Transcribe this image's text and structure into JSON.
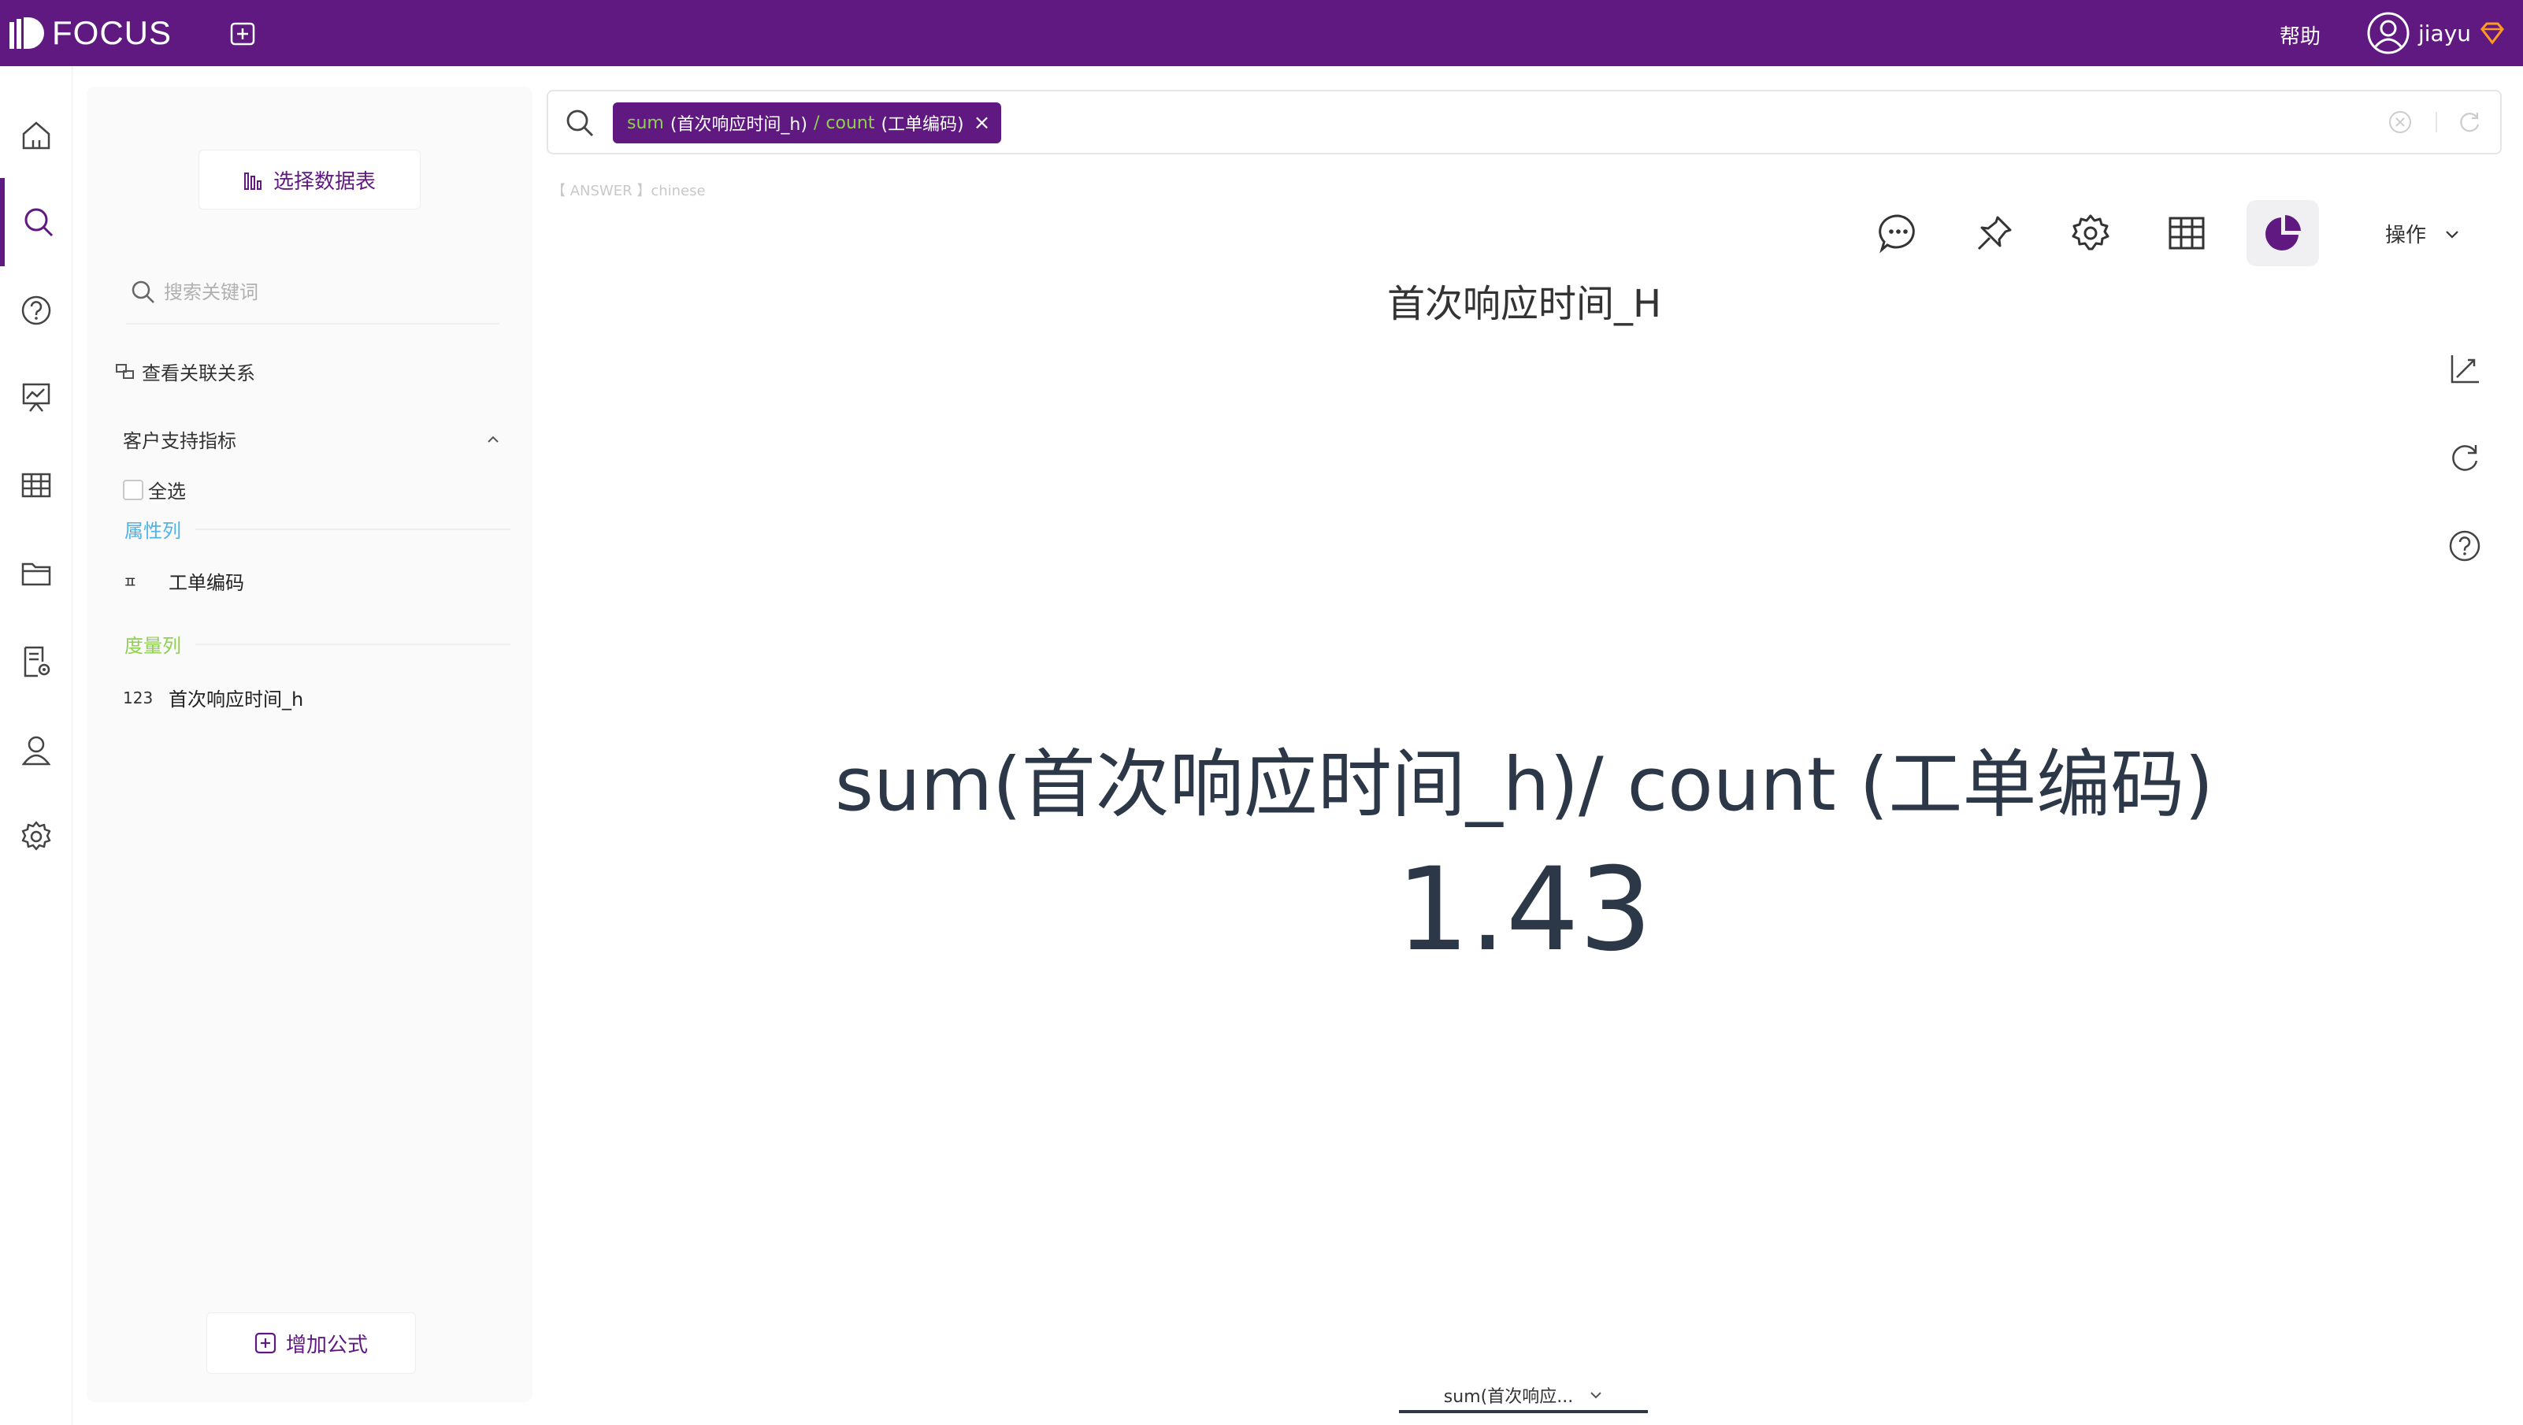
{
  "app": {
    "logo_text": "FOCUS",
    "help_label": "帮助",
    "user_name": "jiayu"
  },
  "colors": {
    "brand": "#5f1981",
    "token_function": "#8fd14f",
    "attribute_label": "#4fb3e6",
    "measure_label": "#8fd14f",
    "metric_text": "#2c3848"
  },
  "left_nav": {
    "items": [
      {
        "icon": "home-icon",
        "active": false
      },
      {
        "icon": "search-icon",
        "active": true
      },
      {
        "icon": "question-icon",
        "active": false
      },
      {
        "icon": "presentation-icon",
        "active": false
      },
      {
        "icon": "table-icon",
        "active": false
      },
      {
        "icon": "folder-icon",
        "active": false
      },
      {
        "icon": "document-settings-icon",
        "active": false
      },
      {
        "icon": "user-icon",
        "active": false
      },
      {
        "icon": "gear-icon",
        "active": false
      }
    ]
  },
  "data_panel": {
    "select_table_label": "选择数据表",
    "search_placeholder": "搜索关键词",
    "view_relations_label": "查看关联关系",
    "group_name": "客户支持指标",
    "select_all_label": "全选",
    "attribute_section_label": "属性列",
    "attribute_fields": [
      {
        "type_label": "ㅍ",
        "name": "工单编码"
      }
    ],
    "measure_section_label": "度量列",
    "measure_fields": [
      {
        "type_label": "123",
        "name": "首次响应时间_h"
      }
    ],
    "add_formula_label": "增加公式"
  },
  "search": {
    "token": {
      "fn1": "sum",
      "arg1": "(首次响应时间_h)",
      "op": "/",
      "fn2": "count",
      "arg2": "(工单编码)",
      "close": "×"
    },
    "answer_hint": "【 ANSWER 】chinese"
  },
  "toolbar": {
    "tools": [
      "comment-icon",
      "pin-icon",
      "settings-icon",
      "table-view-icon",
      "pie-chart-icon"
    ],
    "active_tool": "pie-chart-icon",
    "operations_label": "操作"
  },
  "result": {
    "title": "首次响应时间_H",
    "metric_label": "sum(首次响应时间_h)/ count (工单编码)",
    "metric_value": "1.43"
  },
  "bottom_tab": {
    "label": "sum(首次响应..."
  }
}
